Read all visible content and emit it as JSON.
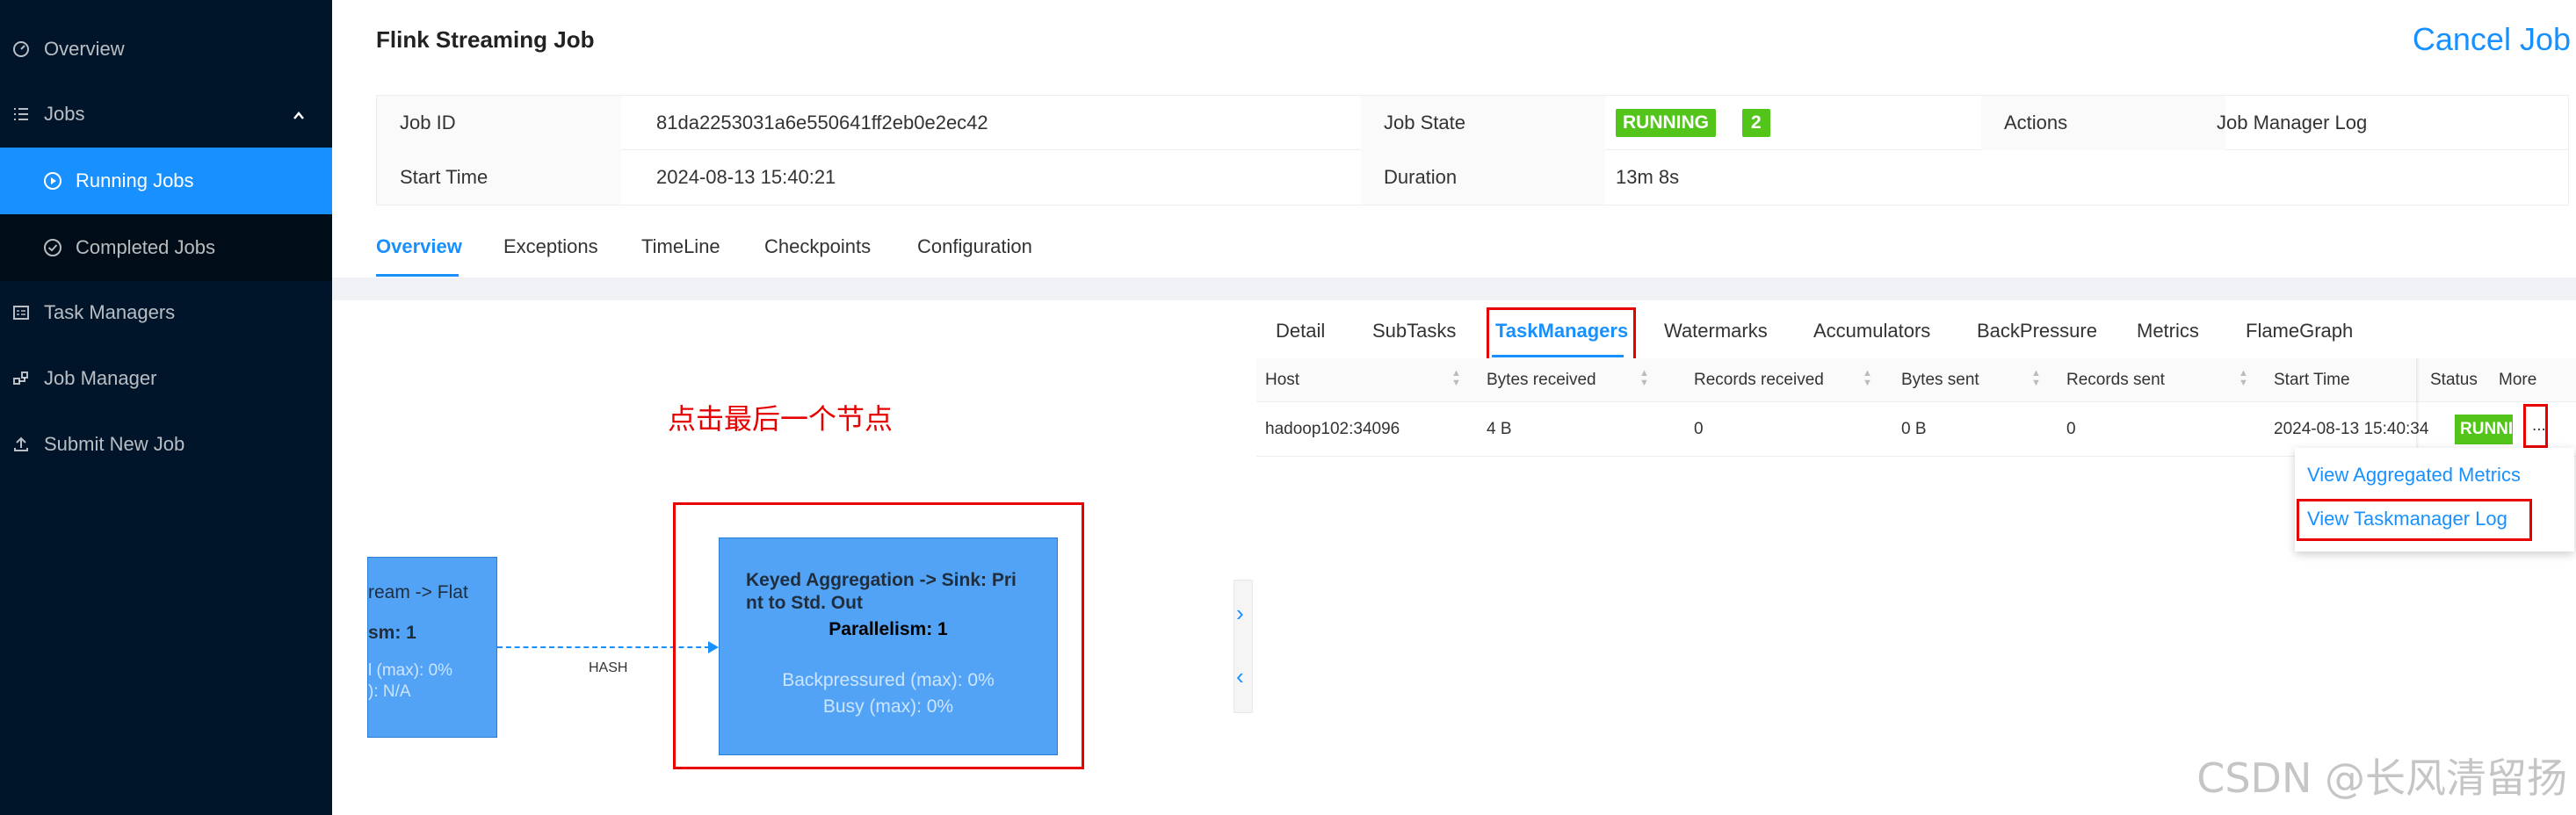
{
  "sidebar": {
    "items": [
      {
        "label": "Overview",
        "icon": "dashboard-icon"
      },
      {
        "label": "Jobs",
        "icon": "list-icon"
      },
      {
        "label": "Running Jobs",
        "icon": "play-circle-icon"
      },
      {
        "label": "Completed Jobs",
        "icon": "check-circle-icon"
      },
      {
        "label": "Task Managers",
        "icon": "schedule-icon"
      },
      {
        "label": "Job Manager",
        "icon": "cluster-icon"
      },
      {
        "label": "Submit New Job",
        "icon": "upload-icon"
      }
    ],
    "accent_color": "#1890ff",
    "background_color": "#001529"
  },
  "header": {
    "title": "Flink Streaming Job",
    "cancel_label": "Cancel Job"
  },
  "info": {
    "job_id_label": "Job ID",
    "job_id": "81da2253031a6e550641ff2eb0e2ec42",
    "start_time_label": "Start Time",
    "start_time": "2024-08-13 15:40:21",
    "job_state_label": "Job State",
    "job_state": "RUNNING",
    "running_count": "2",
    "duration_label": "Duration",
    "duration": "13m 8s",
    "actions_label": "Actions",
    "job_manager_log": "Job Manager Log"
  },
  "tabs": [
    "Overview",
    "Exceptions",
    "TimeLine",
    "Checkpoints",
    "Configuration"
  ],
  "graph": {
    "annotation": "点击最后一个节点",
    "node1": {
      "line1": "ream -> Flat",
      "line2": "sm: 1",
      "line3": "l (max): 0%",
      "line4": "): N/A"
    },
    "node2": {
      "line1": "Keyed Aggregation -> Sink: Pri",
      "line2": "nt to Std. Out",
      "parallelism": "Parallelism: 1",
      "backpressured": "Backpressured (max): 0%",
      "busy": "Busy (max): 0%"
    },
    "edge_label": "HASH"
  },
  "subtabs": [
    "Detail",
    "SubTasks",
    "TaskManagers",
    "Watermarks",
    "Accumulators",
    "BackPressure",
    "Metrics",
    "FlameGraph"
  ],
  "taskmanagers": {
    "columns": [
      "Host",
      "Bytes received",
      "Records received",
      "Bytes sent",
      "Records sent",
      "Start Time",
      "Status",
      "More"
    ],
    "rows": [
      {
        "host": "hadoop102:34096",
        "bytes_received": "4 B",
        "records_received": "0",
        "bytes_sent": "0 B",
        "records_sent": "0",
        "start_time": "2024-08-13 15:40:34",
        "status": "RUNNING",
        "more": "..."
      }
    ]
  },
  "dropdown": {
    "items": [
      "View Aggregated Metrics",
      "View Taskmanager Log"
    ]
  },
  "watermark": "CSDN @长风清留扬",
  "colors": {
    "running": "#52c41a",
    "annotation": "#e60000",
    "node": "#52a3f5"
  }
}
